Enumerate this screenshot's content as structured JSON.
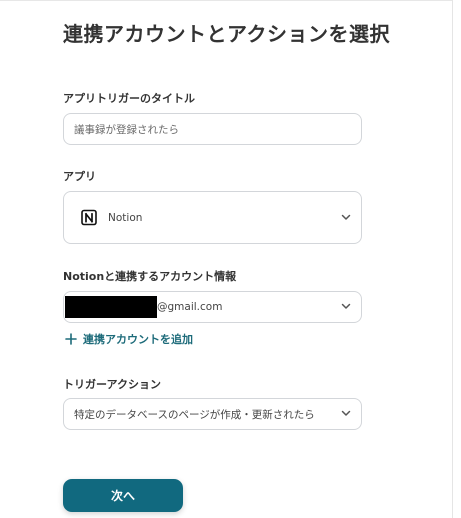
{
  "page": {
    "title": "連携アカウントとアクションを選択"
  },
  "trigger_title": {
    "label": "アプリトリガーのタイトル",
    "value": "議事録が登録されたら"
  },
  "app": {
    "label": "アプリ",
    "selected": "Notion",
    "icon": "notion-logo-icon"
  },
  "account": {
    "label": "Notionと連携するアカウント情報",
    "email_suffix": "@gmail.com",
    "add_link": "連携アカウントを追加",
    "add_icon": "plus-icon"
  },
  "trigger_action": {
    "label": "トリガーアクション",
    "selected": "特定のデータベースのページが作成・更新されたら"
  },
  "footer": {
    "next_label": "次へ"
  },
  "colors": {
    "accent": "#11697f",
    "link": "#1d6b7a",
    "border": "#d3d6da"
  }
}
